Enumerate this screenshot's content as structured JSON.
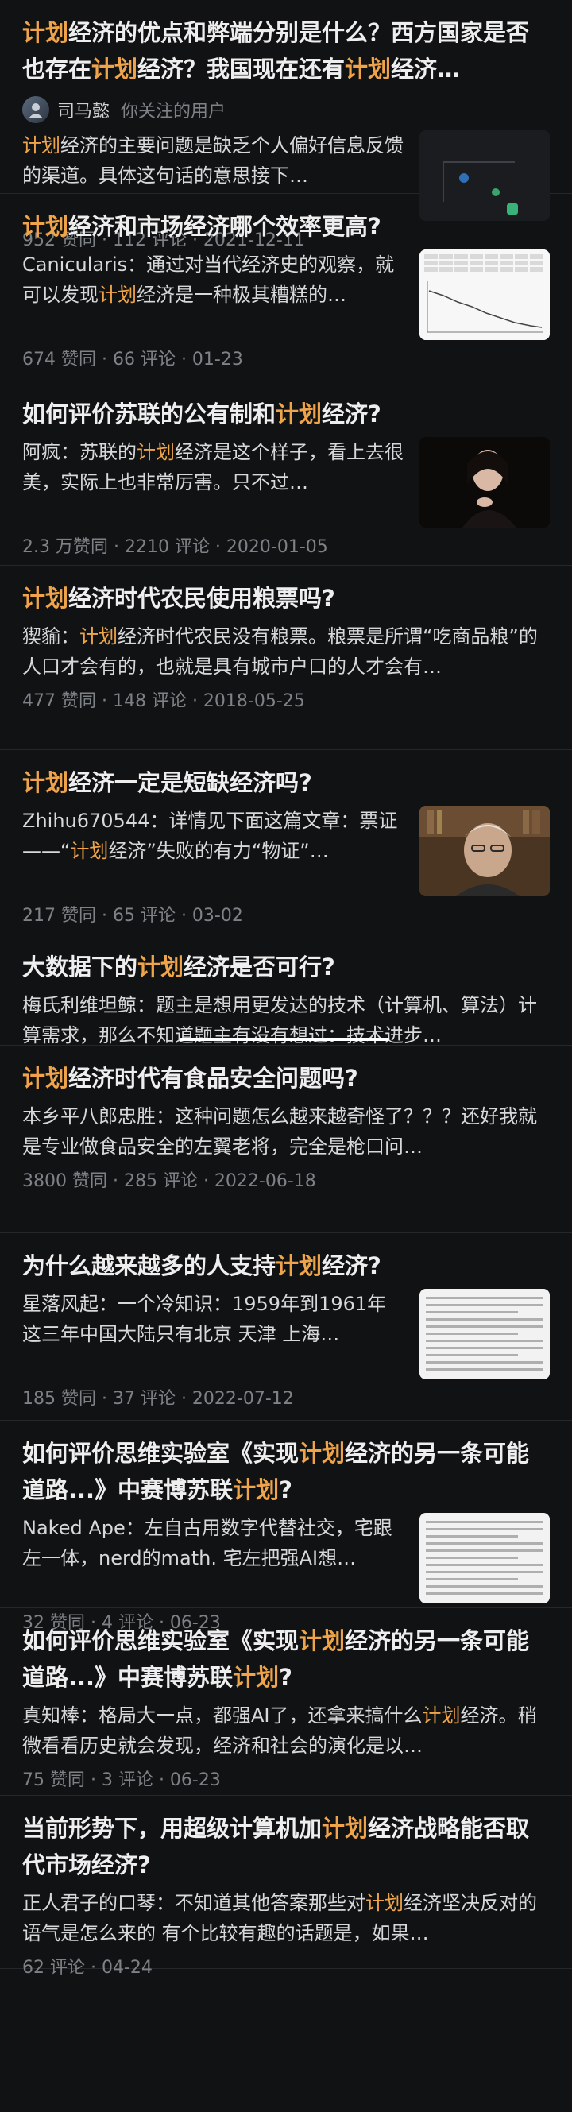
{
  "colors": {
    "background": "#111213",
    "highlight": "#f0a44a",
    "title": "#eeeeef",
    "meta": "#7e8186"
  },
  "items": [
    {
      "title_parts": [
        {
          "t": "计划",
          "h": true
        },
        {
          "t": "经济的优点和弊端分别是什么？西方国家是否也存在",
          "h": false
        },
        {
          "t": "计划",
          "h": true
        },
        {
          "t": "经济？我国现在还有",
          "h": false
        },
        {
          "t": "计划",
          "h": true
        },
        {
          "t": "经济…",
          "h": false
        }
      ],
      "author": {
        "name": "司马懿",
        "tag": "你关注的用户"
      },
      "excerpt_parts": [
        {
          "t": "计划",
          "h": true
        },
        {
          "t": "经济的主要问题是缺乏个人偏好信息反馈的渠道。具体这句话的意思接下…",
          "h": false
        }
      ],
      "meta": "952 赞同 · 112 评论 · 2021-12-11",
      "thumb": "dark"
    },
    {
      "title_parts": [
        {
          "t": "计划",
          "h": true
        },
        {
          "t": "经济和市场经济哪个效率更高?",
          "h": false
        }
      ],
      "excerpt_parts": [
        {
          "t": "Canicularis：通过对当代经济史的观察，就可以发现",
          "h": false
        },
        {
          "t": "计划",
          "h": true
        },
        {
          "t": "经济是一种极其糟糕的…",
          "h": false
        }
      ],
      "meta": "674 赞同 · 66 评论 · 01-23",
      "thumb": "chart"
    },
    {
      "title_parts": [
        {
          "t": "如何评价苏联的公有制和",
          "h": false
        },
        {
          "t": "计划",
          "h": true
        },
        {
          "t": "经济?",
          "h": false
        }
      ],
      "excerpt_parts": [
        {
          "t": "阿疯：苏联的",
          "h": false
        },
        {
          "t": "计划",
          "h": true
        },
        {
          "t": "经济是这个样子，看上去很美，实际上也非常厉害。只不过…",
          "h": false
        }
      ],
      "meta": "2.3 万赞同 · 2210 评论 · 2020-01-05",
      "thumb": "woman"
    },
    {
      "title_parts": [
        {
          "t": "计划",
          "h": true
        },
        {
          "t": "经济时代农民使用粮票吗?",
          "h": false
        }
      ],
      "excerpt_parts": [
        {
          "t": "猰貐：",
          "h": false
        },
        {
          "t": "计划",
          "h": true
        },
        {
          "t": "经济时代农民没有粮票。粮票是所谓“吃商品粮”的人口才会有的，也就是具有城市户口的人才会有…",
          "h": false
        }
      ],
      "meta": "477 赞同 · 148 评论 · 2018-05-25",
      "thumb": ""
    },
    {
      "title_parts": [
        {
          "t": "计划",
          "h": true
        },
        {
          "t": "经济一定是短缺经济吗?",
          "h": false
        }
      ],
      "excerpt_parts": [
        {
          "t": "Zhihu670544：详情见下面这篇文章：票证——“",
          "h": false
        },
        {
          "t": "计划",
          "h": true
        },
        {
          "t": "经济”失败的有力“物证”…",
          "h": false
        }
      ],
      "meta": "217 赞同 · 65 评论 · 03-02",
      "thumb": "man"
    },
    {
      "title_parts": [
        {
          "t": "大数据下的",
          "h": false
        },
        {
          "t": "计划",
          "h": true
        },
        {
          "t": "经济是否可行?",
          "h": false
        }
      ],
      "excerpt_parts": [
        {
          "t": "梅氏利维坦鲸：题主是想用更发达的技术（计算机、算法）计算需求，那么不知道题主有没有想过：技术进步…",
          "h": false
        }
      ],
      "meta": "",
      "thumb": "",
      "underline": true
    },
    {
      "title_parts": [
        {
          "t": "计划",
          "h": true
        },
        {
          "t": "经济时代有食品安全问题吗?",
          "h": false
        }
      ],
      "excerpt_parts": [
        {
          "t": "本乡平八郎忠胜：这种问题怎么越来越奇怪了？？？还好我就是专业做食品安全的左翼老将，完全是枪口问…",
          "h": false
        }
      ],
      "meta": "3800 赞同 · 285 评论 · 2022-06-18",
      "thumb": ""
    },
    {
      "title_parts": [
        {
          "t": "为什么越来越多的人支持",
          "h": false
        },
        {
          "t": "计划",
          "h": true
        },
        {
          "t": "经济?",
          "h": false
        }
      ],
      "excerpt_parts": [
        {
          "t": "星落风起：一个冷知识：1959年到1961年这三年中国大陆只有北京 天津 上海…",
          "h": false
        }
      ],
      "meta": "185 赞同 · 37 评论 · 2022-07-12",
      "thumb": "doc"
    },
    {
      "title_parts": [
        {
          "t": "如何评价思维实验室《实现",
          "h": false
        },
        {
          "t": "计划",
          "h": true
        },
        {
          "t": "经济的另一条可能道路...》中赛博苏联",
          "h": false
        },
        {
          "t": "计划",
          "h": true
        },
        {
          "t": "?",
          "h": false
        }
      ],
      "excerpt_parts": [
        {
          "t": "Naked Ape：左自古用数字代替社交，宅跟左一体，nerd的math. 宅左把强AI想…",
          "h": false
        }
      ],
      "meta": "32 赞同 · 4 评论 · 06-23",
      "thumb": "doc"
    },
    {
      "title_parts": [
        {
          "t": "如何评价思维实验室《实现",
          "h": false
        },
        {
          "t": "计划",
          "h": true
        },
        {
          "t": "经济的另一条可能道路...》中赛博苏联",
          "h": false
        },
        {
          "t": "计划",
          "h": true
        },
        {
          "t": "?",
          "h": false
        }
      ],
      "excerpt_parts": [
        {
          "t": "真知棒：格局大一点，都强AI了，还拿来搞什么",
          "h": false
        },
        {
          "t": "计划",
          "h": true
        },
        {
          "t": "经济。稍微看看历史就会发现，经济和社会的演化是以…",
          "h": false
        }
      ],
      "meta": "75 赞同 · 3 评论 · 06-23",
      "thumb": ""
    },
    {
      "title_parts": [
        {
          "t": "当前形势下，用超级计算机加",
          "h": false
        },
        {
          "t": "计划",
          "h": true
        },
        {
          "t": "经济战略能否取代市场经济?",
          "h": false
        }
      ],
      "excerpt_parts": [
        {
          "t": "正人君子的口琴：不知道其他答案那些对",
          "h": false
        },
        {
          "t": "计划",
          "h": true
        },
        {
          "t": "经济坚决反对的语气是怎么来的 有个比较有趣的话题是，如果…",
          "h": false
        }
      ],
      "meta": "62 评论 · 04-24",
      "thumb": ""
    }
  ]
}
